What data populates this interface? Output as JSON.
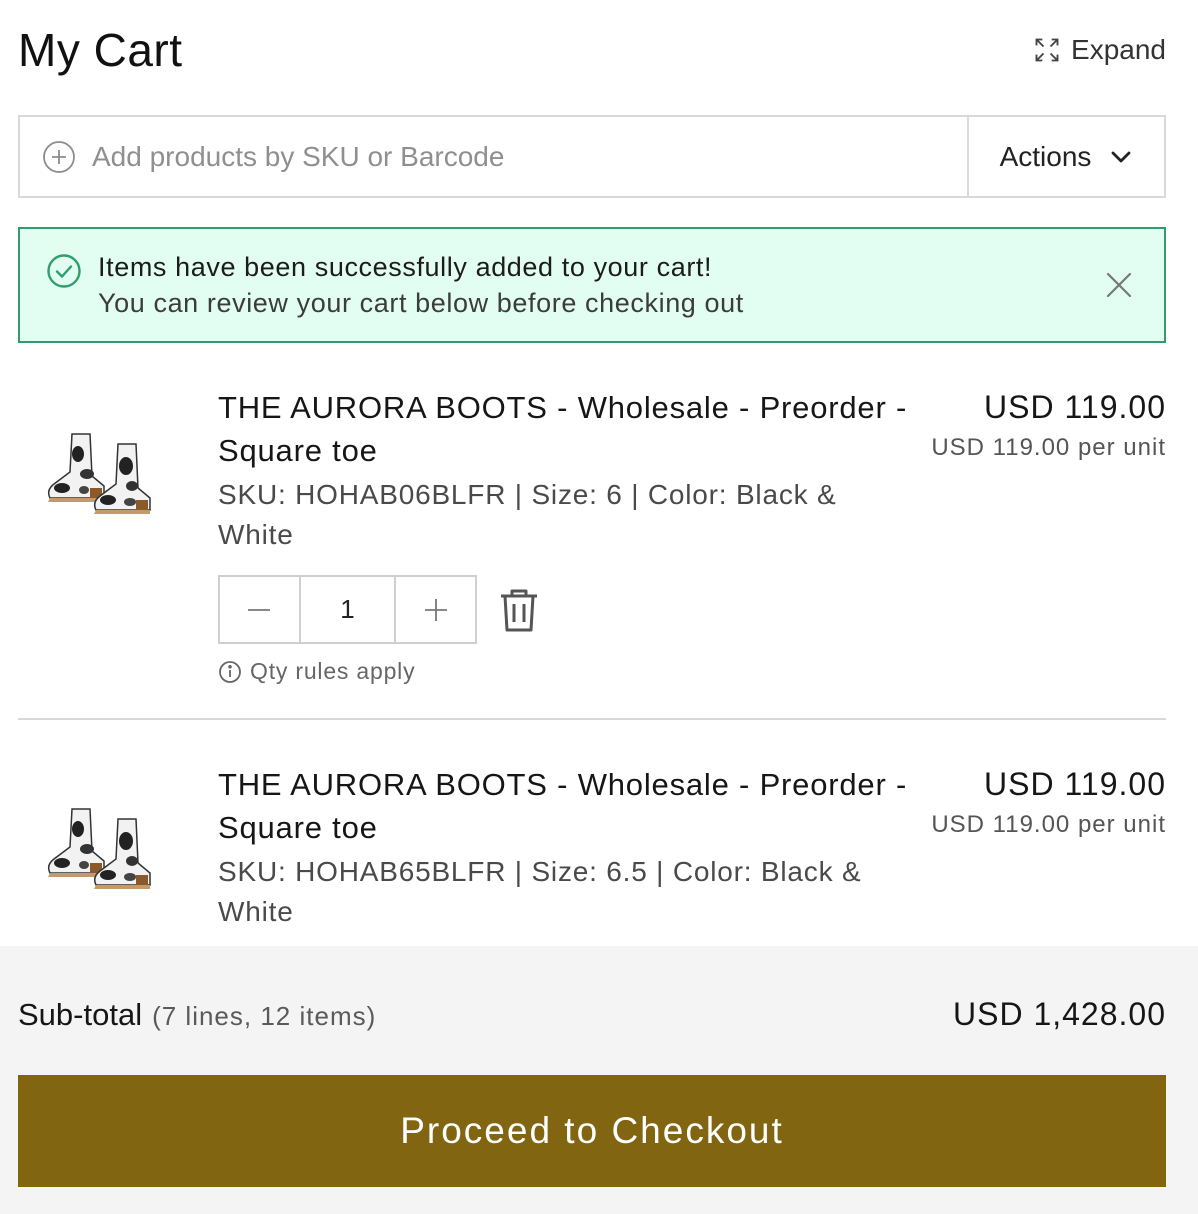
{
  "header": {
    "title": "My Cart",
    "expand_label": "Expand"
  },
  "add_bar": {
    "placeholder": "Add products by SKU or Barcode",
    "actions_label": "Actions"
  },
  "alert": {
    "title": "Items have been successfully added to your cart!",
    "message": "You can review your cart below before checking out"
  },
  "items": [
    {
      "name": "THE AURORA BOOTS - Wholesale - Preorder - Square toe",
      "meta": "SKU: HOHAB06BLFR | Size: 6 | Color: Black & White",
      "price": "USD 119.00",
      "unit_price": "USD 119.00 per unit",
      "quantity": "1",
      "qty_rules": "Qty rules apply"
    },
    {
      "name": "THE AURORA BOOTS - Wholesale - Preorder - Square toe",
      "meta": "SKU: HOHAB65BLFR | Size: 6.5 | Color: Black & White",
      "price": "USD 119.00",
      "unit_price": "USD 119.00 per unit"
    }
  ],
  "footer": {
    "subtotal_label": "Sub-total",
    "subtotal_counts": "(7 lines,  12 items)",
    "subtotal_value": "USD 1,428.00",
    "checkout_label": "Proceed to Checkout"
  },
  "colors": {
    "accent": "#826511",
    "success_bg": "#e2fdf2",
    "success_border": "#2f9e6c"
  }
}
